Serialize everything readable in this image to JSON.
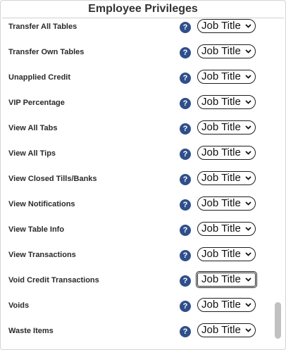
{
  "title": "Employee Privileges",
  "select_value": "Job Title",
  "help_glyph": "?",
  "rows": [
    {
      "label": "Transfer All Tables"
    },
    {
      "label": "Transfer Own Tables"
    },
    {
      "label": "Unapplied Credit"
    },
    {
      "label": "VIP Percentage"
    },
    {
      "label": "View All Tabs"
    },
    {
      "label": "View All Tips"
    },
    {
      "label": "View Closed Tills/Banks"
    },
    {
      "label": "View Notifications"
    },
    {
      "label": "View Table Info"
    },
    {
      "label": "View Transactions"
    },
    {
      "label": "Void Credit Transactions"
    },
    {
      "label": "Voids"
    },
    {
      "label": "Waste Items"
    }
  ],
  "colors": {
    "help_icon": "#2f4f8b",
    "scrollbar": "#c1c1c1"
  }
}
